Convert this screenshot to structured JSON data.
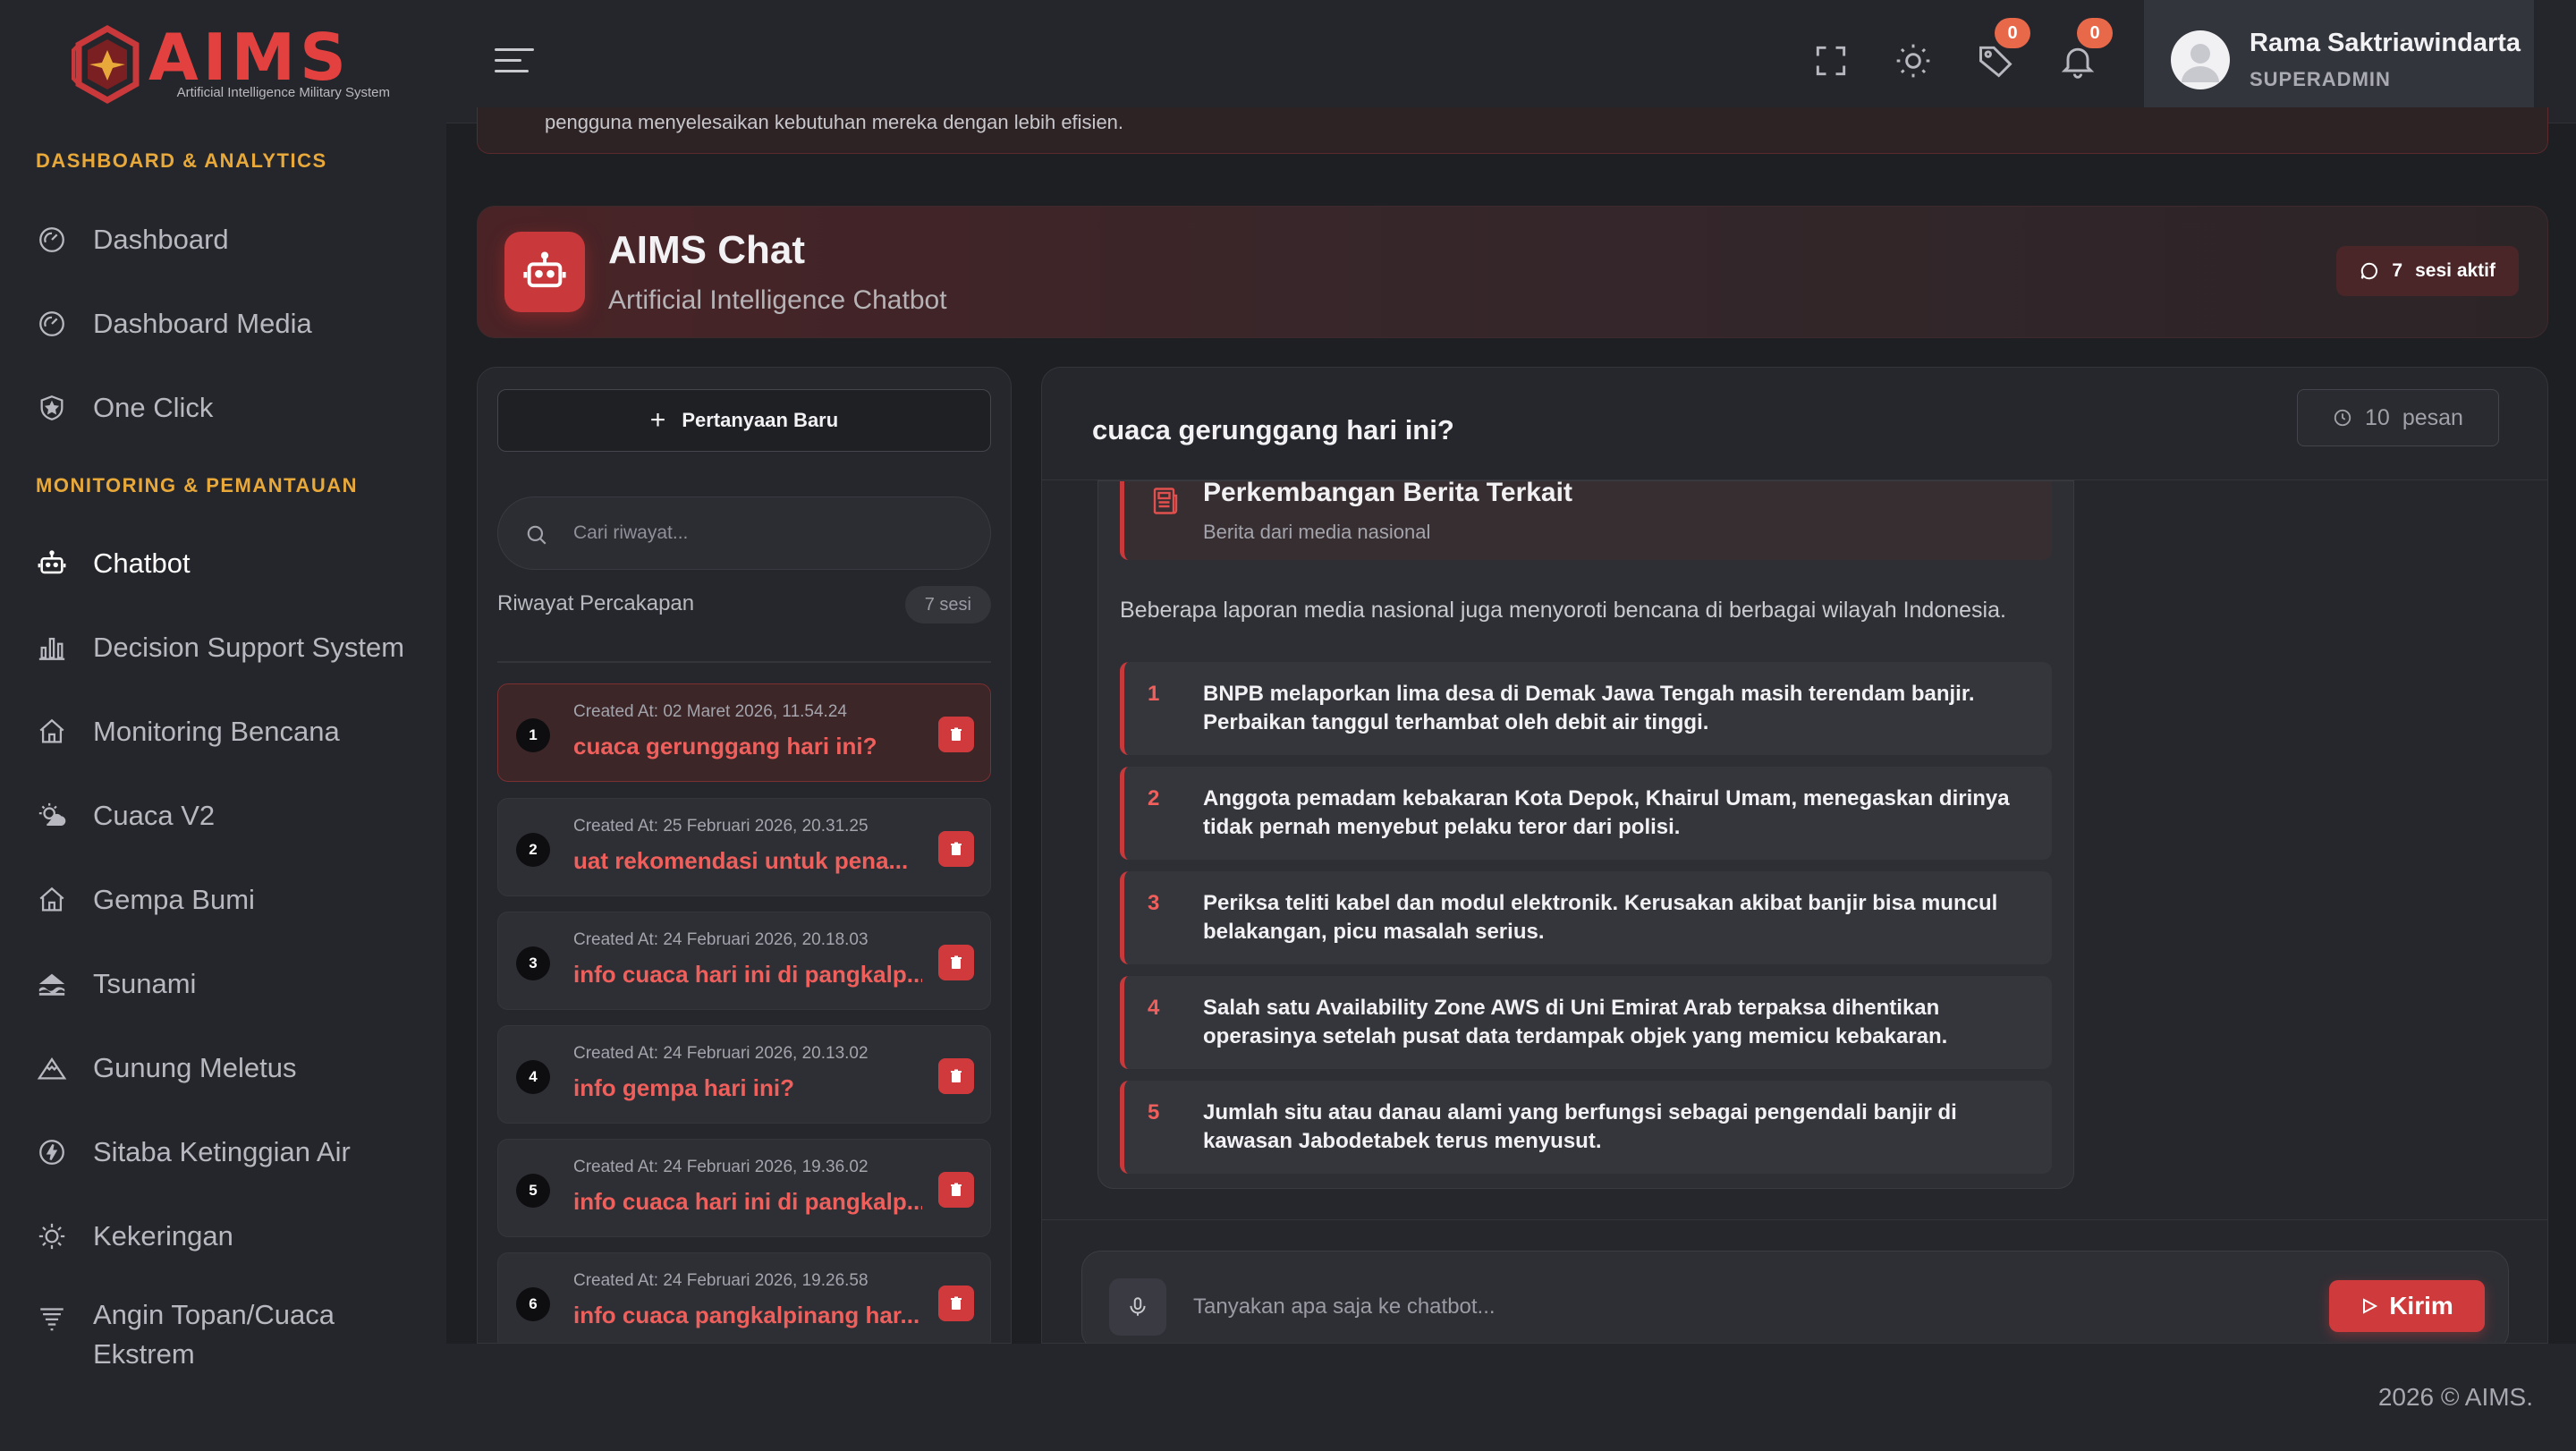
{
  "brand": {
    "name": "AIMS",
    "subtitle": "Artificial Intelligence Military System"
  },
  "sidebar": {
    "sections": [
      {
        "title": "DASHBOARD & ANALYTICS"
      },
      {
        "title": "MONITORING & PEMANTAUAN"
      }
    ],
    "items": [
      {
        "label": "Dashboard",
        "icon": "gauge-icon"
      },
      {
        "label": "Dashboard Media",
        "icon": "gauge-icon"
      },
      {
        "label": "One Click",
        "icon": "shield-icon"
      },
      {
        "label": "Chatbot",
        "icon": "robot-icon",
        "active": true
      },
      {
        "label": "Decision Support System",
        "icon": "bar-chart-icon"
      },
      {
        "label": "Monitoring Bencana",
        "icon": "house-icon"
      },
      {
        "label": "Cuaca V2",
        "icon": "sun-cloud-icon"
      },
      {
        "label": "Gempa Bumi",
        "icon": "house-icon"
      },
      {
        "label": "Tsunami",
        "icon": "wave-icon"
      },
      {
        "label": "Gunung Meletus",
        "icon": "mountain-icon"
      },
      {
        "label": "Sitaba Ketinggian Air",
        "icon": "water-drop-icon"
      },
      {
        "label": "Kekeringan",
        "icon": "sun-icon"
      },
      {
        "label": "Angin Topan/Cuaca Ekstrem",
        "icon": "wind-icon"
      }
    ]
  },
  "topbar": {
    "tag_badge": "0",
    "bell_badge": "0",
    "user": {
      "name": "Rama Saktriawindarta",
      "role": "SUPERADMIN"
    }
  },
  "notice": {
    "text": "pengguna menyelesaikan kebutuhan mereka dengan lebih efisien."
  },
  "chat_header": {
    "title": "AIMS Chat",
    "subtitle": "Artificial Intelligence Chatbot",
    "sessions_count": "7",
    "sessions_label": "sesi aktif"
  },
  "history": {
    "new_button": "Pertanyaan Baru",
    "search_placeholder": "Cari riwayat...",
    "label": "Riwayat Percakapan",
    "count": "7 sesi",
    "items": [
      {
        "num": "1",
        "date": "Created At: 02 Maret 2026, 11.54.24",
        "title": "cuaca gerunggang hari ini?",
        "active": true
      },
      {
        "num": "2",
        "date": "Created At: 25 Februari 2026, 20.31.25",
        "title": "uat rekomendasi untuk pena..."
      },
      {
        "num": "3",
        "date": "Created At: 24 Februari 2026, 20.18.03",
        "title": "info cuaca hari ini di pangkalp..."
      },
      {
        "num": "4",
        "date": "Created At: 24 Februari 2026, 20.13.02",
        "title": "info gempa hari ini?"
      },
      {
        "num": "5",
        "date": "Created At: 24 Februari 2026, 19.36.02",
        "title": "info cuaca hari ini di pangkalp..."
      },
      {
        "num": "6",
        "date": "Created At: 24 Februari 2026, 19.26.58",
        "title": "info cuaca pangkalpinang har..."
      }
    ]
  },
  "chat": {
    "question": "cuaca gerunggang hari ini?",
    "message_count": "10",
    "message_label": "pesan",
    "news": {
      "title": "Perkembangan Berita Terkait",
      "subtitle": "Berita dari media nasional",
      "intro": "Beberapa laporan media nasional juga menyoroti bencana di berbagai wilayah Indonesia.",
      "items": [
        {
          "num": "1",
          "text": "BNPB melaporkan lima desa di Demak Jawa Tengah masih terendam banjir. Perbaikan tanggul terhambat oleh debit air tinggi."
        },
        {
          "num": "2",
          "text": "Anggota pemadam kebakaran Kota Depok, Khairul Umam, menegaskan dirinya tidak pernah menyebut pelaku teror dari polisi."
        },
        {
          "num": "3",
          "text": "Periksa teliti kabel dan modul elektronik. Kerusakan akibat banjir bisa muncul belakangan, picu masalah serius."
        },
        {
          "num": "4",
          "text": "Salah satu Availability Zone AWS di Uni Emirat Arab terpaksa dihentikan operasinya setelah pusat data terdampak objek yang memicu kebakaran."
        },
        {
          "num": "5",
          "text": "Jumlah situ atau danau alami yang berfungsi sebagai pengendali banjir di kawasan Jabodetabek terus menyusut."
        }
      ]
    },
    "input_placeholder": "Tanyakan apa saja ke chatbot...",
    "send_label": "Kirim"
  },
  "footer": {
    "text": "2026 © AIMS."
  },
  "colors": {
    "accent": "#cf3b3d",
    "section": "#e8a93a",
    "badge": "#e8684a",
    "background": "#1e1f23"
  }
}
